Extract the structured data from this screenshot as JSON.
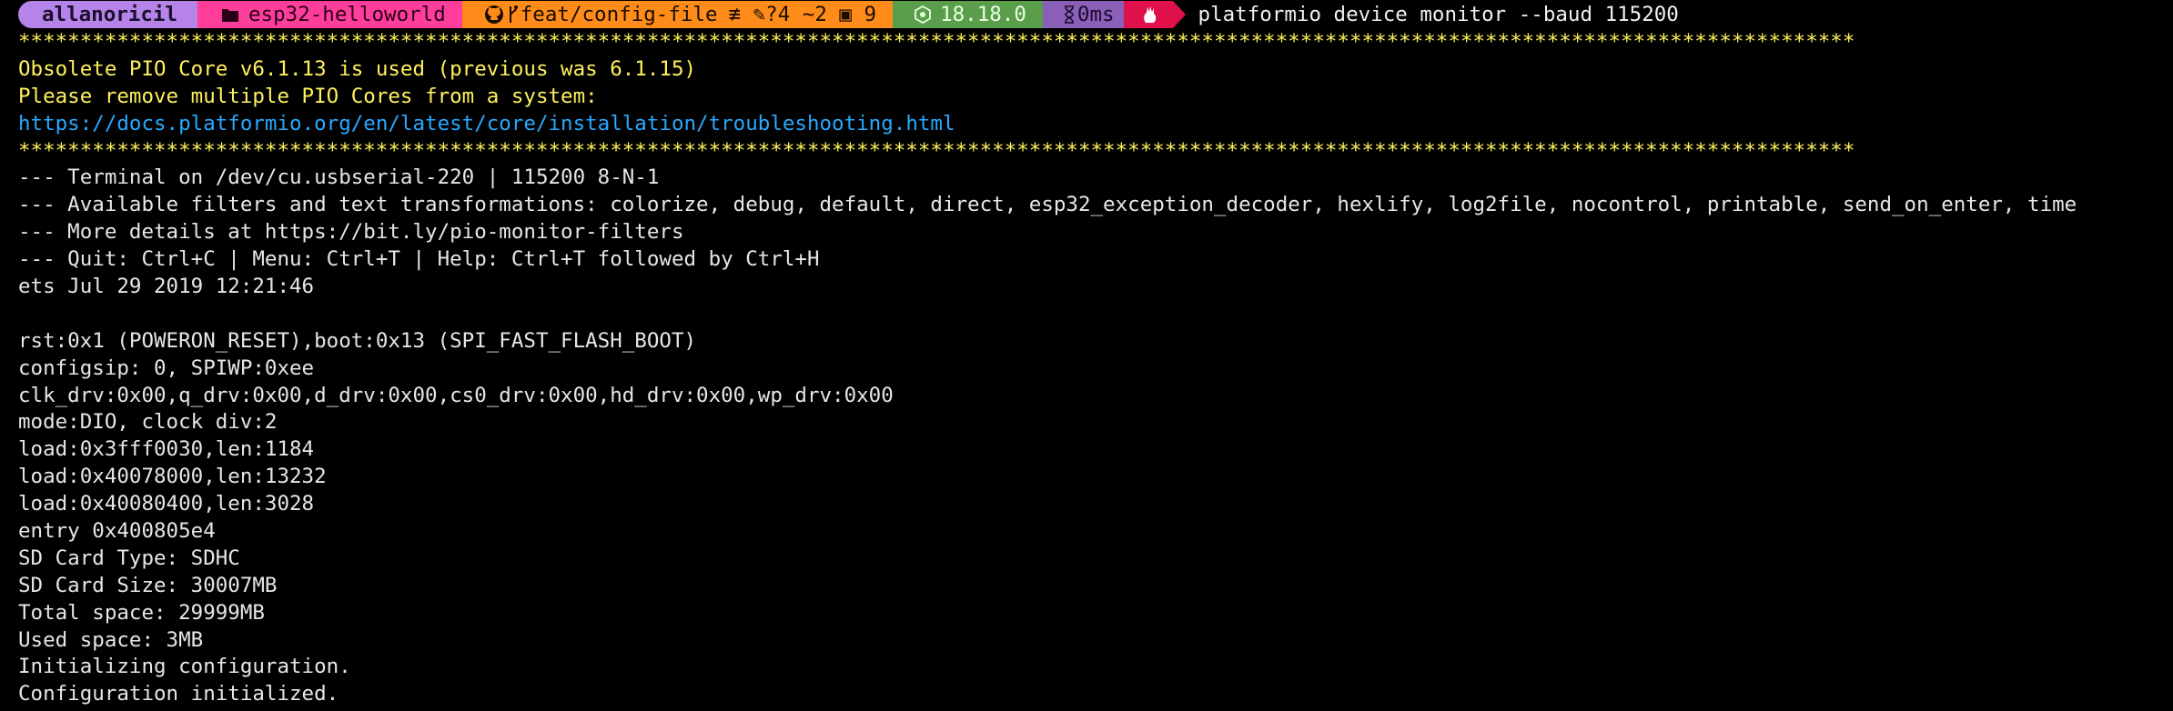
{
  "prompt": {
    "user": "allanoricil",
    "directory": "esp32-helloworld",
    "git_branch": "feat/config-file",
    "git_status": "≢ ✎?4 ~2 ▣ 9",
    "node_version": "18.18.0",
    "exec_time": "0ms",
    "command": "platformio device monitor --baud 115200"
  },
  "colors": {
    "user_segment": "#b684e8",
    "path_segment": "#ff3d9a",
    "git_segment": "#ff8c1a",
    "node_segment": "#5a9e4c",
    "exec_segment": "#8a5fb8",
    "shell_segment": "#e0114a",
    "warning_text": "#fff15c",
    "link_text": "#29a8ff"
  },
  "icons": {
    "folder": "folder-icon",
    "github": "github-icon",
    "branch": "branch-icon",
    "node": "nodejs-icon",
    "hourglass": "hourglass-icon",
    "shell": "shell-icon"
  },
  "output": {
    "stars": "*****************************************************************************************************************************************************",
    "warning_1": "Obsolete PIO Core v6.1.13 is used (previous was 6.1.15)",
    "warning_2": "Please remove multiple PIO Cores from a system:",
    "warning_link": "https://docs.platformio.org/en/latest/core/installation/troubleshooting.html",
    "stars_2": "*****************************************************************************************************************************************************",
    "monitor_1": "--- Terminal on /dev/cu.usbserial-220 | 115200 8-N-1",
    "monitor_2": "--- Available filters and text transformations: colorize, debug, default, direct, esp32_exception_decoder, hexlify, log2file, nocontrol, printable, send_on_enter, time",
    "monitor_3": "--- More details at https://bit.ly/pio-monitor-filters",
    "monitor_4": "--- Quit: Ctrl+C | Menu: Ctrl+T | Help: Ctrl+T followed by Ctrl+H",
    "boot_1": "ets Jul 29 2019 12:21:46",
    "boot_2": "rst:0x1 (POWERON_RESET),boot:0x13 (SPI_FAST_FLASH_BOOT)",
    "boot_3": "configsip: 0, SPIWP:0xee",
    "boot_4": "clk_drv:0x00,q_drv:0x00,d_drv:0x00,cs0_drv:0x00,hd_drv:0x00,wp_drv:0x00",
    "boot_5": "mode:DIO, clock div:2",
    "boot_6": "load:0x3fff0030,len:1184",
    "boot_7": "load:0x40078000,len:13232",
    "boot_8": "load:0x40080400,len:3028",
    "boot_9": "entry 0x400805e4",
    "app_1": "SD Card Type: SDHC",
    "app_2": "SD Card Size: 30007MB",
    "app_3": "Total space: 29999MB",
    "app_4": "Used space: 3MB",
    "app_5": "Initializing configuration.",
    "app_6": "Configuration initialized."
  }
}
